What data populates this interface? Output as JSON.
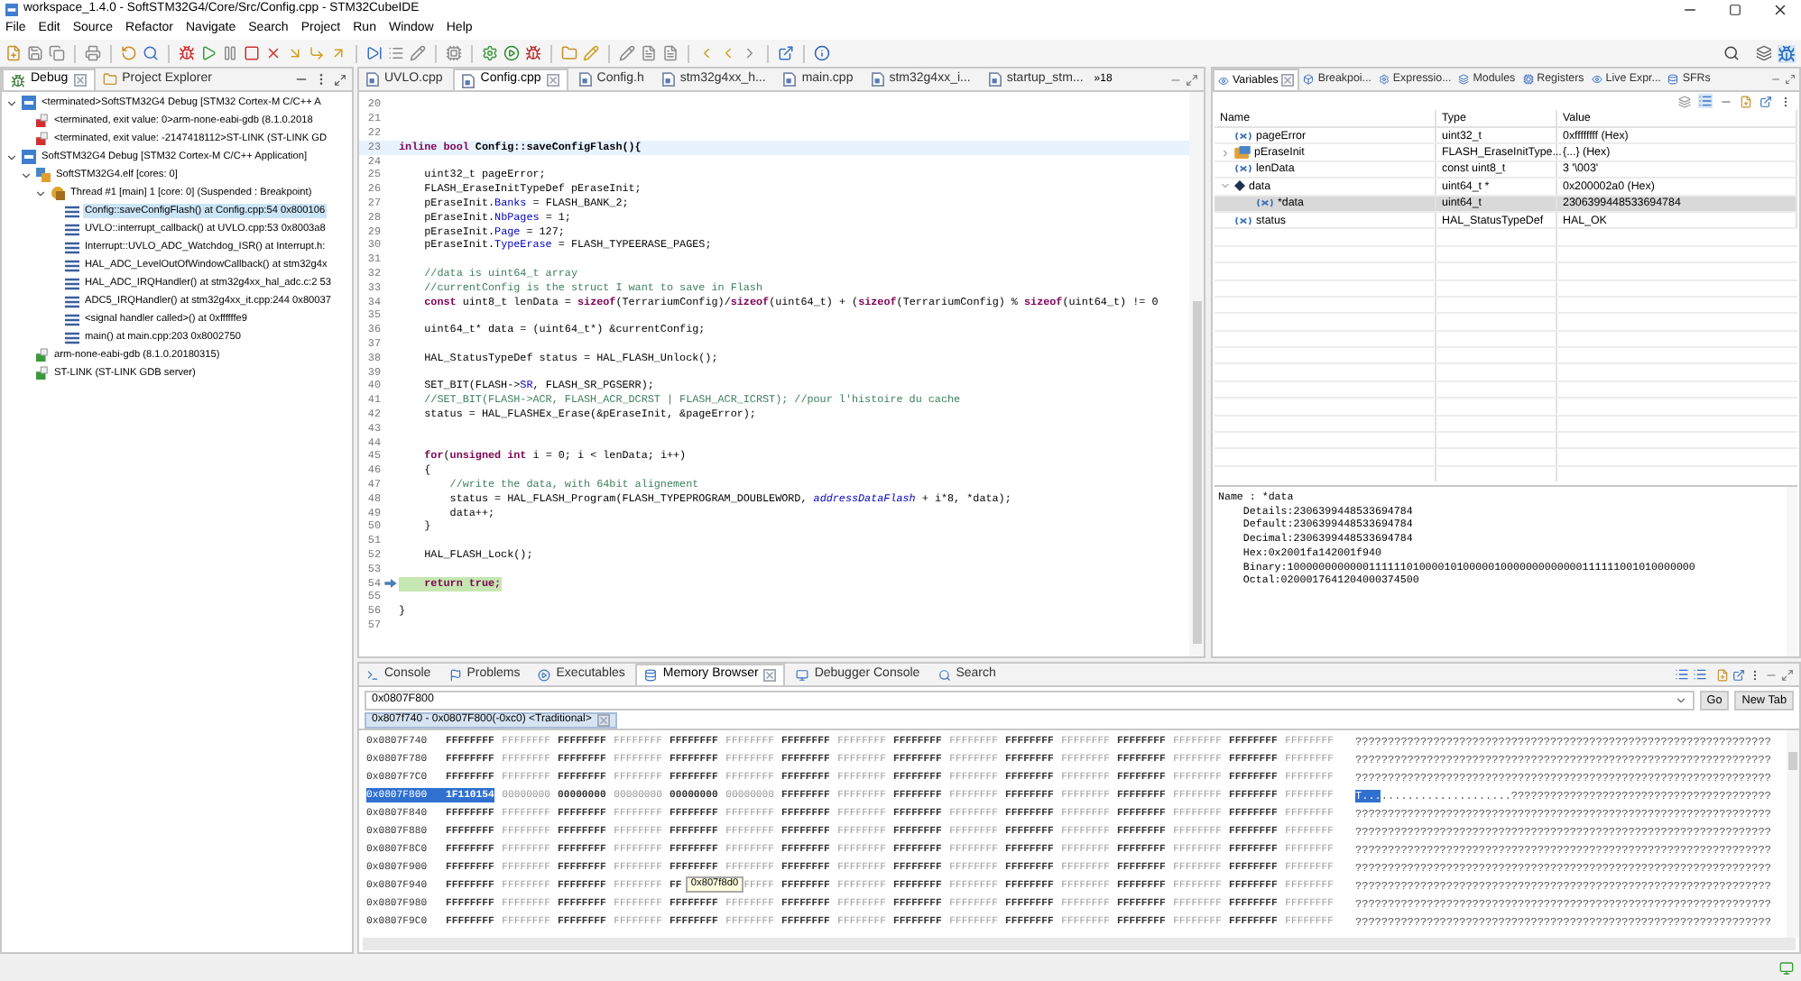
{
  "window": {
    "title": "workspace_1.4.0 - SoftSTM32G4/Core/Src/Config.cpp - STM32CubeIDE"
  },
  "menu": [
    "File",
    "Edit",
    "Source",
    "Refactor",
    "Navigate",
    "Search",
    "Project",
    "Run",
    "Window",
    "Help"
  ],
  "debug_view": {
    "tabs": [
      {
        "label": "Debug",
        "selected": true
      },
      {
        "label": "Project Explorer",
        "selected": false
      }
    ],
    "tree": [
      {
        "kind": "launch",
        "label": "<terminated>SoftSTM32G4 Debug [STM32 Cortex-M C/C++ A",
        "expanded": true,
        "selected": false,
        "children": [
          {
            "kind": "terminated",
            "label": "<terminated, exit value: 0>arm-none-eabi-gdb (8.1.0.2018",
            "selected": false
          },
          {
            "kind": "terminated",
            "label": "<terminated, exit value: -2147418112>ST-LINK (ST-LINK GD",
            "selected": false
          }
        ]
      },
      {
        "kind": "launch",
        "label": "SoftSTM32G4 Debug [STM32 Cortex-M C/C++ Application]",
        "expanded": true,
        "selected": false,
        "children": [
          {
            "kind": "elf",
            "label": "SoftSTM32G4.elf [cores: 0]",
            "expanded": true,
            "selected": false,
            "children": [
              {
                "kind": "thread",
                "label": "Thread #1 [main] 1 [core: 0] (Suspended : Breakpoint)",
                "expanded": true,
                "selected": false,
                "children": [
                  {
                    "kind": "frame",
                    "label": "Config::saveConfigFlash() at Config.cpp:54 0x800106",
                    "selected": true
                  },
                  {
                    "kind": "frame",
                    "label": "UVLO::interrupt_callback() at UVLO.cpp:53 0x8003a8",
                    "selected": false
                  },
                  {
                    "kind": "frame",
                    "label": "Interrupt::UVLO_ADC_Watchdog_ISR() at Interrupt.h:",
                    "selected": false
                  },
                  {
                    "kind": "frame",
                    "label": "HAL_ADC_LevelOutOfWindowCallback() at stm32g4x",
                    "selected": false
                  },
                  {
                    "kind": "frame",
                    "label": "HAL_ADC_IRQHandler() at stm32g4xx_hal_adc.c:2 53",
                    "selected": false
                  },
                  {
                    "kind": "frame",
                    "label": "ADC5_IRQHandler() at stm32g4xx_it.cpp:244 0x80037",
                    "selected": false
                  },
                  {
                    "kind": "frame",
                    "label": "<signal handler called>() at 0xffffffe9",
                    "selected": false
                  },
                  {
                    "kind": "frame",
                    "label": "main() at main.cpp:203 0x8002750",
                    "selected": false
                  }
                ]
              }
            ]
          },
          {
            "kind": "process",
            "label": "arm-none-eabi-gdb (8.1.0.20180315)",
            "selected": false
          },
          {
            "kind": "process",
            "label": "ST-LINK (ST-LINK GDB server)",
            "selected": false
          }
        ]
      }
    ]
  },
  "editor": {
    "tabs": [
      {
        "label": "UVLO.cpp",
        "selected": false
      },
      {
        "label": "Config.cpp",
        "selected": true
      },
      {
        "label": "Config.h",
        "selected": false
      },
      {
        "label": "stm32g4xx_h...",
        "selected": false
      },
      {
        "label": "main.cpp",
        "selected": false
      },
      {
        "label": "stm32g4xx_i...",
        "selected": false
      },
      {
        "label": "startup_stm...",
        "selected": false
      }
    ],
    "overflow": "»18",
    "lines": [
      {
        "number": "20",
        "kind": "normal"
      },
      {
        "number": "21",
        "kind": "normal"
      },
      {
        "number": "22",
        "kind": "normal"
      },
      {
        "number": "23",
        "kind": "current",
        "segments": [
          {
            "kind": "keyword",
            "text": "inline bool"
          },
          {
            "kind": "bold",
            "text": " Config::saveConfigFlash(){"
          }
        ]
      },
      {
        "number": "24",
        "kind": "normal"
      },
      {
        "number": "25",
        "kind": "normal",
        "segments": [
          {
            "kind": "plain",
            "text": "    uint32_t pageError;"
          }
        ]
      },
      {
        "number": "26",
        "kind": "normal",
        "segments": [
          {
            "kind": "plain",
            "text": "    FLASH_EraseInitTypeDef pEraseInit;"
          }
        ]
      },
      {
        "number": "27",
        "kind": "normal",
        "segments": [
          {
            "kind": "plain",
            "text": "    pEraseInit."
          },
          {
            "kind": "field",
            "text": "Banks"
          },
          {
            "kind": "plain",
            "text": " = FLASH_BANK_2;"
          }
        ]
      },
      {
        "number": "28",
        "kind": "normal",
        "segments": [
          {
            "kind": "plain",
            "text": "    pEraseInit."
          },
          {
            "kind": "field",
            "text": "NbPages"
          },
          {
            "kind": "plain",
            "text": " = 1;"
          }
        ]
      },
      {
        "number": "29",
        "kind": "normal",
        "segments": [
          {
            "kind": "plain",
            "text": "    pEraseInit."
          },
          {
            "kind": "field",
            "text": "Page"
          },
          {
            "kind": "plain",
            "text": " = 127;"
          }
        ]
      },
      {
        "number": "30",
        "kind": "normal",
        "segments": [
          {
            "kind": "plain",
            "text": "    pEraseInit."
          },
          {
            "kind": "field",
            "text": "TypeErase"
          },
          {
            "kind": "plain",
            "text": " = FLASH_TYPEERASE_PAGES;"
          }
        ]
      },
      {
        "number": "31",
        "kind": "normal"
      },
      {
        "number": "32",
        "kind": "normal",
        "segments": [
          {
            "kind": "comment",
            "text": "    //data is uint64_t array"
          }
        ]
      },
      {
        "number": "33",
        "kind": "normal",
        "segments": [
          {
            "kind": "comment",
            "text": "    //currentConfig is the struct I want to save in Flash"
          }
        ]
      },
      {
        "number": "34",
        "kind": "normal",
        "segments": [
          {
            "kind": "keyword",
            "text": "    const"
          },
          {
            "kind": "plain",
            "text": " uint8_t lenData = "
          },
          {
            "kind": "keyword",
            "text": "sizeof"
          },
          {
            "kind": "plain",
            "text": "(TerrariumConfig)/"
          },
          {
            "kind": "keyword",
            "text": "sizeof"
          },
          {
            "kind": "plain",
            "text": "(uint64_t) + ("
          },
          {
            "kind": "keyword",
            "text": "sizeof"
          },
          {
            "kind": "plain",
            "text": "(TerrariumConfig) % "
          },
          {
            "kind": "keyword",
            "text": "sizeof"
          },
          {
            "kind": "plain",
            "text": "(uint64_t) != 0"
          }
        ]
      },
      {
        "number": "35",
        "kind": "normal"
      },
      {
        "number": "36",
        "kind": "normal",
        "segments": [
          {
            "kind": "plain",
            "text": "    uint64_t* data = (uint64_t*) &currentConfig;"
          }
        ]
      },
      {
        "number": "37",
        "kind": "normal"
      },
      {
        "number": "38",
        "kind": "normal",
        "segments": [
          {
            "kind": "plain",
            "text": "    HAL_StatusTypeDef status = HAL_FLASH_Unlock();"
          }
        ]
      },
      {
        "number": "39",
        "kind": "normal"
      },
      {
        "number": "40",
        "kind": "normal",
        "segments": [
          {
            "kind": "plain",
            "text": "    SET_BIT(FLASH->"
          },
          {
            "kind": "field",
            "text": "SR"
          },
          {
            "kind": "plain",
            "text": ", FLASH_SR_PGSERR);"
          }
        ]
      },
      {
        "number": "41",
        "kind": "normal",
        "segments": [
          {
            "kind": "comment",
            "text": "    //SET_BIT(FLASH->ACR, FLASH_ACR_DCRST | FLASH_ACR_ICRST); //pour l'histoire du cache"
          }
        ]
      },
      {
        "number": "42",
        "kind": "normal",
        "segments": [
          {
            "kind": "plain",
            "text": "    status = HAL_FLASHEx_Erase(&pEraseInit, &pageError);"
          }
        ]
      },
      {
        "number": "43",
        "kind": "normal"
      },
      {
        "number": "44",
        "kind": "normal"
      },
      {
        "number": "45",
        "kind": "normal",
        "segments": [
          {
            "kind": "keyword",
            "text": "    for"
          },
          {
            "kind": "plain",
            "text": "("
          },
          {
            "kind": "keyword",
            "text": "unsigned int"
          },
          {
            "kind": "plain",
            "text": " i = 0; i < lenData; i++)"
          }
        ]
      },
      {
        "number": "46",
        "kind": "normal",
        "segments": [
          {
            "kind": "plain",
            "text": "    {"
          }
        ]
      },
      {
        "number": "47",
        "kind": "normal",
        "segments": [
          {
            "kind": "comment",
            "text": "        //write the data, with 64bit alignement"
          }
        ]
      },
      {
        "number": "48",
        "kind": "normal",
        "segments": [
          {
            "kind": "plain",
            "text": "        status = HAL_FLASH_Program(FLASH_TYPEPROGRAM_DOUBLEWORD, "
          },
          {
            "kind": "italic",
            "text": "addressDataFlash"
          },
          {
            "kind": "plain",
            "text": " + i*8, *data);"
          }
        ]
      },
      {
        "number": "49",
        "kind": "normal",
        "segments": [
          {
            "kind": "plain",
            "text": "        data++;"
          }
        ]
      },
      {
        "number": "50",
        "kind": "normal",
        "segments": [
          {
            "kind": "plain",
            "text": "    }"
          }
        ]
      },
      {
        "number": "51",
        "kind": "normal"
      },
      {
        "number": "52",
        "kind": "normal",
        "segments": [
          {
            "kind": "plain",
            "text": "    HAL_FLASH_Lock();"
          }
        ]
      },
      {
        "number": "53",
        "kind": "normal"
      },
      {
        "number": "54",
        "kind": "stopped",
        "segments": [
          {
            "kind": "keyword",
            "text": "    return true;"
          }
        ]
      },
      {
        "number": "55",
        "kind": "normal"
      },
      {
        "number": "56",
        "kind": "normal",
        "segments": [
          {
            "kind": "plain",
            "text": "}"
          }
        ]
      },
      {
        "number": "57",
        "kind": "normal"
      }
    ]
  },
  "variables": {
    "tabs": [
      {
        "label": "Variables",
        "selected": true
      },
      {
        "label": "Breakpoi...",
        "selected": false
      },
      {
        "label": "Expressio...",
        "selected": false
      },
      {
        "label": "Modules",
        "selected": false
      },
      {
        "label": "Registers",
        "selected": false
      },
      {
        "label": "Live Expr...",
        "selected": false
      },
      {
        "label": "SFRs",
        "selected": false
      }
    ],
    "columns": [
      "Name",
      "Type",
      "Value"
    ],
    "rows": [
      {
        "kind": "variable",
        "name": "pageError",
        "type": "uint32_t",
        "value": "0xffffffff (Hex)",
        "selected": false
      },
      {
        "kind": "struct",
        "name": "pEraseInit",
        "type": "FLASH_EraseInitType...",
        "value": "{...} (Hex)",
        "expanded": false,
        "selected": false
      },
      {
        "kind": "variable",
        "name": "lenData",
        "type": "const uint8_t",
        "value": "3 '\\003'",
        "selected": false
      },
      {
        "kind": "pointer",
        "name": "data",
        "type": "uint64_t *",
        "value": "0x200002a0 (Hex)",
        "expanded": true,
        "selected": false,
        "children": [
          {
            "kind": "variable",
            "name": "*data",
            "type": "uint64_t",
            "value": "2306399448533694784",
            "selected": true
          }
        ]
      },
      {
        "kind": "variable",
        "name": "status",
        "type": "HAL_StatusTypeDef",
        "value": "HAL_OK",
        "selected": false
      }
    ],
    "details": [
      "Name : *data",
      "    Details:2306399448533694784",
      "    Default:2306399448533694784",
      "    Decimal:2306399448533694784",
      "    Hex:0x2001fa142001f940",
      "    Binary:10000000000001111110100001010000010000000000000111111001010000000",
      "    Octal:0200017641204000374500"
    ]
  },
  "bottom": {
    "tabs": [
      {
        "label": "Console",
        "selected": false
      },
      {
        "label": "Problems",
        "selected": false
      },
      {
        "label": "Executables",
        "selected": false
      },
      {
        "label": "Memory Browser",
        "selected": true
      },
      {
        "label": "Debugger Console",
        "selected": false
      },
      {
        "label": "Search",
        "selected": false
      }
    ],
    "address": "0x0807F800",
    "buttons": [
      "Go",
      "New Tab"
    ],
    "rendering_tab": "0x807f740 - 0x0807F800(-0xc0) <Traditional>",
    "tooltip": "0x807f8d0",
    "rows": [
      {
        "address": "0x0807F740",
        "selected": false,
        "words": [
          "FFFFFFFF",
          "FFFFFFFF",
          "FFFFFFFF",
          "FFFFFFFF",
          "FFFFFFFF",
          "FFFFFFFF",
          "FFFFFFFF",
          "FFFFFFFF",
          "FFFFFFFF",
          "FFFFFFFF",
          "FFFFFFFF",
          "FFFFFFFF",
          "FFFFFFFF",
          "FFFFFFFF",
          "FFFFFFFF",
          "FFFFFFFF"
        ],
        "ascii": "????????????????????????????????????????????????????????????????"
      },
      {
        "address": "0x0807F780",
        "selected": false,
        "words": [
          "FFFFFFFF",
          "FFFFFFFF",
          "FFFFFFFF",
          "FFFFFFFF",
          "FFFFFFFF",
          "FFFFFFFF",
          "FFFFFFFF",
          "FFFFFFFF",
          "FFFFFFFF",
          "FFFFFFFF",
          "FFFFFFFF",
          "FFFFFFFF",
          "FFFFFFFF",
          "FFFFFFFF",
          "FFFFFFFF",
          "FFFFFFFF"
        ],
        "ascii": "????????????????????????????????????????????????????????????????"
      },
      {
        "address": "0x0807F7C0",
        "selected": false,
        "words": [
          "FFFFFFFF",
          "FFFFFFFF",
          "FFFFFFFF",
          "FFFFFFFF",
          "FFFFFFFF",
          "FFFFFFFF",
          "FFFFFFFF",
          "FFFFFFFF",
          "FFFFFFFF",
          "FFFFFFFF",
          "FFFFFFFF",
          "FFFFFFFF",
          "FFFFFFFF",
          "FFFFFFFF",
          "FFFFFFFF",
          "FFFFFFFF"
        ],
        "ascii": "????????????????????????????????????????????????????????????????"
      },
      {
        "address": "0x0807F800",
        "selected": true,
        "words": [
          "1F110154",
          "00000000",
          "00000000",
          "00000000",
          "00000000",
          "00000000",
          "FFFFFFFF",
          "FFFFFFFF",
          "FFFFFFFF",
          "FFFFFFFF",
          "FFFFFFFF",
          "FFFFFFFF",
          "FFFFFFFF",
          "FFFFFFFF",
          "FFFFFFFF",
          "FFFFFFFF"
        ],
        "ascii_selected": "T...",
        "ascii": "....................????????????????????????????????????????"
      },
      {
        "address": "0x0807F840",
        "selected": false,
        "words": [
          "FFFFFFFF",
          "FFFFFFFF",
          "FFFFFFFF",
          "FFFFFFFF",
          "FFFFFFFF",
          "FFFFFFFF",
          "FFFFFFFF",
          "FFFFFFFF",
          "FFFFFFFF",
          "FFFFFFFF",
          "FFFFFFFF",
          "FFFFFFFF",
          "FFFFFFFF",
          "FFFFFFFF",
          "FFFFFFFF",
          "FFFFFFFF"
        ],
        "ascii": "????????????????????????????????????????????????????????????????"
      },
      {
        "address": "0x0807F880",
        "selected": false,
        "words": [
          "FFFFFFFF",
          "FFFFFFFF",
          "FFFFFFFF",
          "FFFFFFFF",
          "FFFFFFFF",
          "FFFFFFFF",
          "FFFFFFFF",
          "FFFFFFFF",
          "FFFFFFFF",
          "FFFFFFFF",
          "FFFFFFFF",
          "FFFFFFFF",
          "FFFFFFFF",
          "FFFFFFFF",
          "FFFFFFFF",
          "FFFFFFFF"
        ],
        "ascii": "????????????????????????????????????????????????????????????????"
      },
      {
        "address": "0x0807F8C0",
        "selected": false,
        "words": [
          "FFFFFFFF",
          "FFFFFFFF",
          "FFFFFFFF",
          "FFFFFFFF",
          "FFFFFFFF",
          "FFFFFFFF",
          "FFFFFFFF",
          "FFFFFFFF",
          "FFFFFFFF",
          "FFFFFFFF",
          "FFFFFFFF",
          "FFFFFFFF",
          "FFFFFFFF",
          "FFFFFFFF",
          "FFFFFFFF",
          "FFFFFFFF"
        ],
        "ascii": "????????????????????????????????????????????????????????????????"
      },
      {
        "address": "0x0807F900",
        "selected": false,
        "words": [
          "FFFFFFFF",
          "FFFFFFFF",
          "FFFFFFFF",
          "FFFFFFFF",
          "FFFFFFFF",
          "FFFFFFFF",
          "FFFFFFFF",
          "FFFFFFFF",
          "FFFFFFFF",
          "FFFFFFFF",
          "FFFFFFFF",
          "FFFFFFFF",
          "FFFFFFFF",
          "FFFFFFFF",
          "FFFFFFFF",
          "FFFFFFFF"
        ],
        "ascii": "????????????????????????????????????????????????????????????????"
      },
      {
        "address": "0x0807F940",
        "selected": false,
        "words": [
          "FFFFFFFF",
          "FFFFFFFF",
          "FFFFFFFF",
          "FFFFFFFF",
          "FF",
          "FFFFF",
          "FFFFFFFF",
          "FFFFFFFF",
          "FFFFFFFF",
          "FFFFFFFF",
          "FFFFFFFF",
          "FFFFFFFF",
          "FFFFFFFF",
          "FFFFFFFF",
          "FFFFFFFF",
          "FFFFFFFF"
        ],
        "ascii": "????????????????????????????????????????????????????????????????"
      },
      {
        "address": "0x0807F980",
        "selected": false,
        "words": [
          "FFFFFFFF",
          "FFFFFFFF",
          "FFFFFFFF",
          "FFFFFFFF",
          "FFFFFFFF",
          "FFFFFFFF",
          "FFFFFFFF",
          "FFFFFFFF",
          "FFFFFFFF",
          "FFFFFFFF",
          "FFFFFFFF",
          "FFFFFFFF",
          "FFFFFFFF",
          "FFFFFFFF",
          "FFFFFFFF",
          "FFFFFFFF"
        ],
        "ascii": "????????????????????????????????????????????????????????????????"
      },
      {
        "address": "0x0807F9C0",
        "selected": false,
        "words": [
          "FFFFFFFF",
          "FFFFFFFF",
          "FFFFFFFF",
          "FFFFFFFF",
          "FFFFFFFF",
          "FFFFFFFF",
          "FFFFFFFF",
          "FFFFFFFF",
          "FFFFFFFF",
          "FFFFFFFF",
          "FFFFFFFF",
          "FFFFFFFF",
          "FFFFFFFF",
          "FFFFFFFF",
          "FFFFFFFF",
          "FFFFFFFF"
        ],
        "ascii": "????????????????????????????????????????????????????????????????"
      }
    ]
  }
}
